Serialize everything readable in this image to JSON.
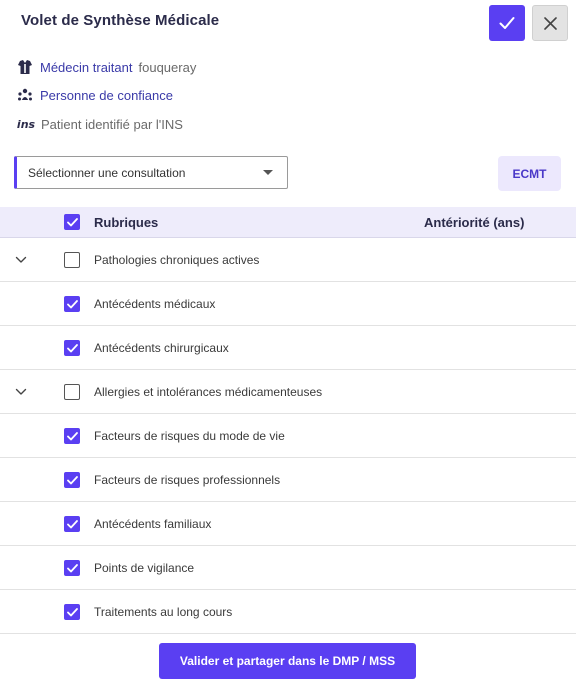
{
  "header": {
    "title": "Volet de Synthèse Médicale",
    "confirm_icon": "check-icon",
    "close_icon": "close-icon"
  },
  "info": {
    "medecin_label": "Médecin traitant",
    "medecin_value": "fouqueray",
    "confiance_label": "Personne de confiance",
    "ins_badge": "ins",
    "ins_label": "Patient identifié par l'INS"
  },
  "select": {
    "value": "Sélectionner une consultation"
  },
  "ecmt_label": "ECMT",
  "table": {
    "col_rubriques": "Rubriques",
    "col_anteriorite": "Antériorité (ans)",
    "rows": [
      {
        "label": "Pathologies chroniques actives",
        "checked": false,
        "expandable": true
      },
      {
        "label": "Antécédents médicaux",
        "checked": true,
        "expandable": false
      },
      {
        "label": "Antécédents chirurgicaux",
        "checked": true,
        "expandable": false
      },
      {
        "label": "Allergies et intolérances médicamenteuses",
        "checked": false,
        "expandable": true
      },
      {
        "label": "Facteurs de risques du mode de vie",
        "checked": true,
        "expandable": false
      },
      {
        "label": "Facteurs de risques professionnels",
        "checked": true,
        "expandable": false
      },
      {
        "label": "Antécédents familiaux",
        "checked": true,
        "expandable": false
      },
      {
        "label": "Points de vigilance",
        "checked": true,
        "expandable": false
      },
      {
        "label": "Traitements au long cours",
        "checked": true,
        "expandable": false
      }
    ]
  },
  "share_button": "Valider et partager dans le DMP / MSS",
  "colors": {
    "accent": "#5a3ff2",
    "header_bg": "#eeecfb",
    "link": "#3a3aa8"
  }
}
